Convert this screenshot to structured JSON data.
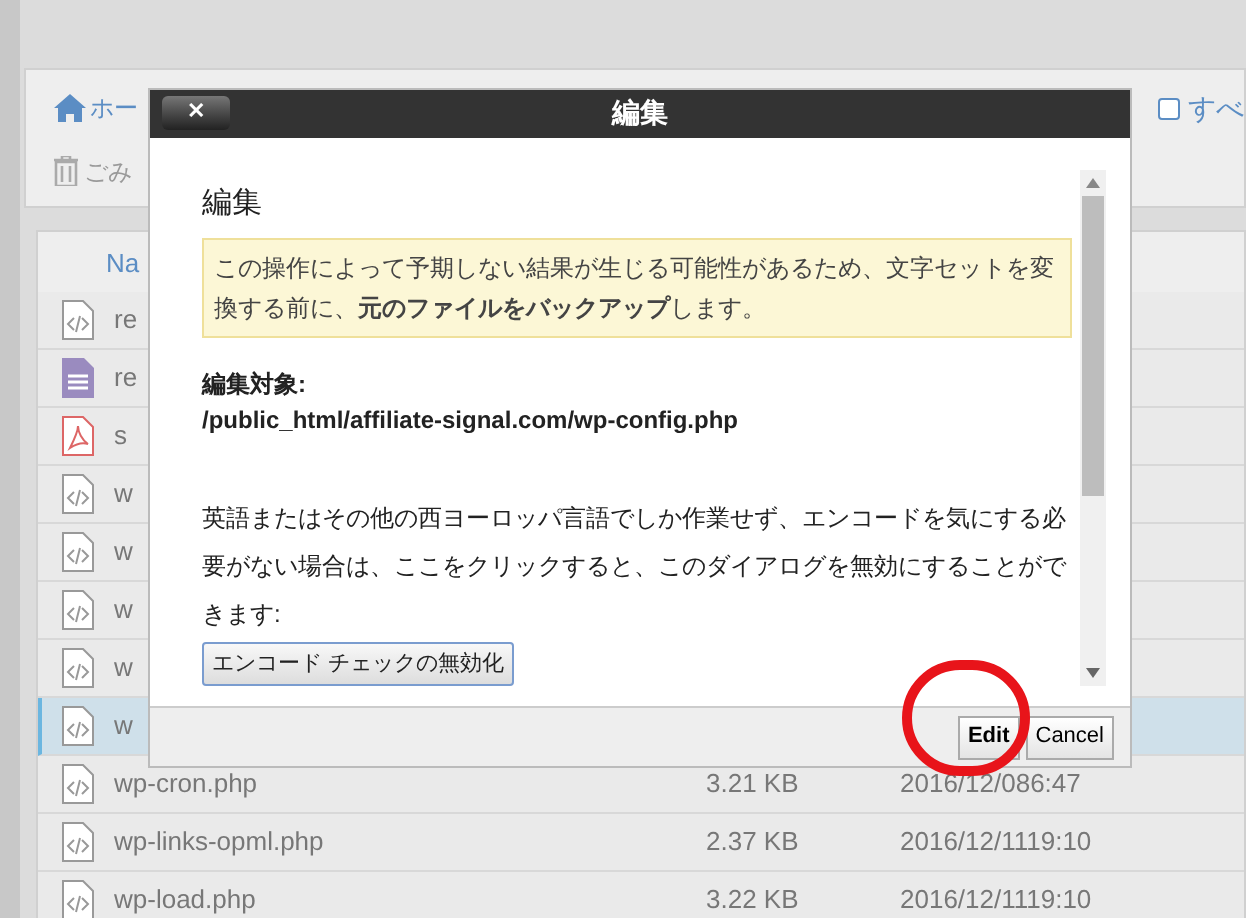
{
  "toolbar": {
    "home_link": "ホー",
    "trash_link": "ごみ",
    "select_all": {
      "label": "すべ",
      "checked": false
    }
  },
  "table": {
    "columns": [
      "Na"
    ],
    "rows": [
      {
        "kind": "code",
        "name": "re",
        "selected": false
      },
      {
        "kind": "doc",
        "name": "re",
        "selected": false
      },
      {
        "kind": "pdf",
        "name": "s",
        "selected": false
      },
      {
        "kind": "code",
        "name": "w",
        "selected": false
      },
      {
        "kind": "code",
        "name": "w",
        "selected": false
      },
      {
        "kind": "code",
        "name": "w",
        "selected": false
      },
      {
        "kind": "code",
        "name": "w",
        "selected": false
      },
      {
        "kind": "code",
        "name": "w",
        "selected": true
      },
      {
        "kind": "code",
        "name": "wp-cron.php",
        "size": "3.21 KB",
        "date": "2016/12/086:47",
        "selected": false
      },
      {
        "kind": "code",
        "name": "wp-links-opml.php",
        "size": "2.37 KB",
        "date": "2016/12/1119:10",
        "selected": false
      },
      {
        "kind": "code",
        "name": "wp-load.php",
        "size": "3.22 KB",
        "date": "2016/12/1119:10",
        "selected": false
      }
    ]
  },
  "dialog": {
    "title": "編集",
    "close_label": "✕",
    "heading": "編集",
    "warning": "この操作によって予期しない結果が生じる可能性があるため、文字セットを変換する前に、**元のファイルをバックアップ**します。",
    "target_label": "編集対象:",
    "target_path": "/public_html/affiliate-signal.com/wp-config.php",
    "info": "英語またはその他の西ヨーロッパ言語でしか作業せず、エンコードを気にする必要がない場合は、ここをクリックすると、このダイアログを無効にすることができます:",
    "disable_button": "エンコード チェックの無効化",
    "buttons": [
      {
        "label": "Edit",
        "kind": "primary"
      },
      {
        "label": "Cancel",
        "kind": "secondary"
      }
    ]
  }
}
